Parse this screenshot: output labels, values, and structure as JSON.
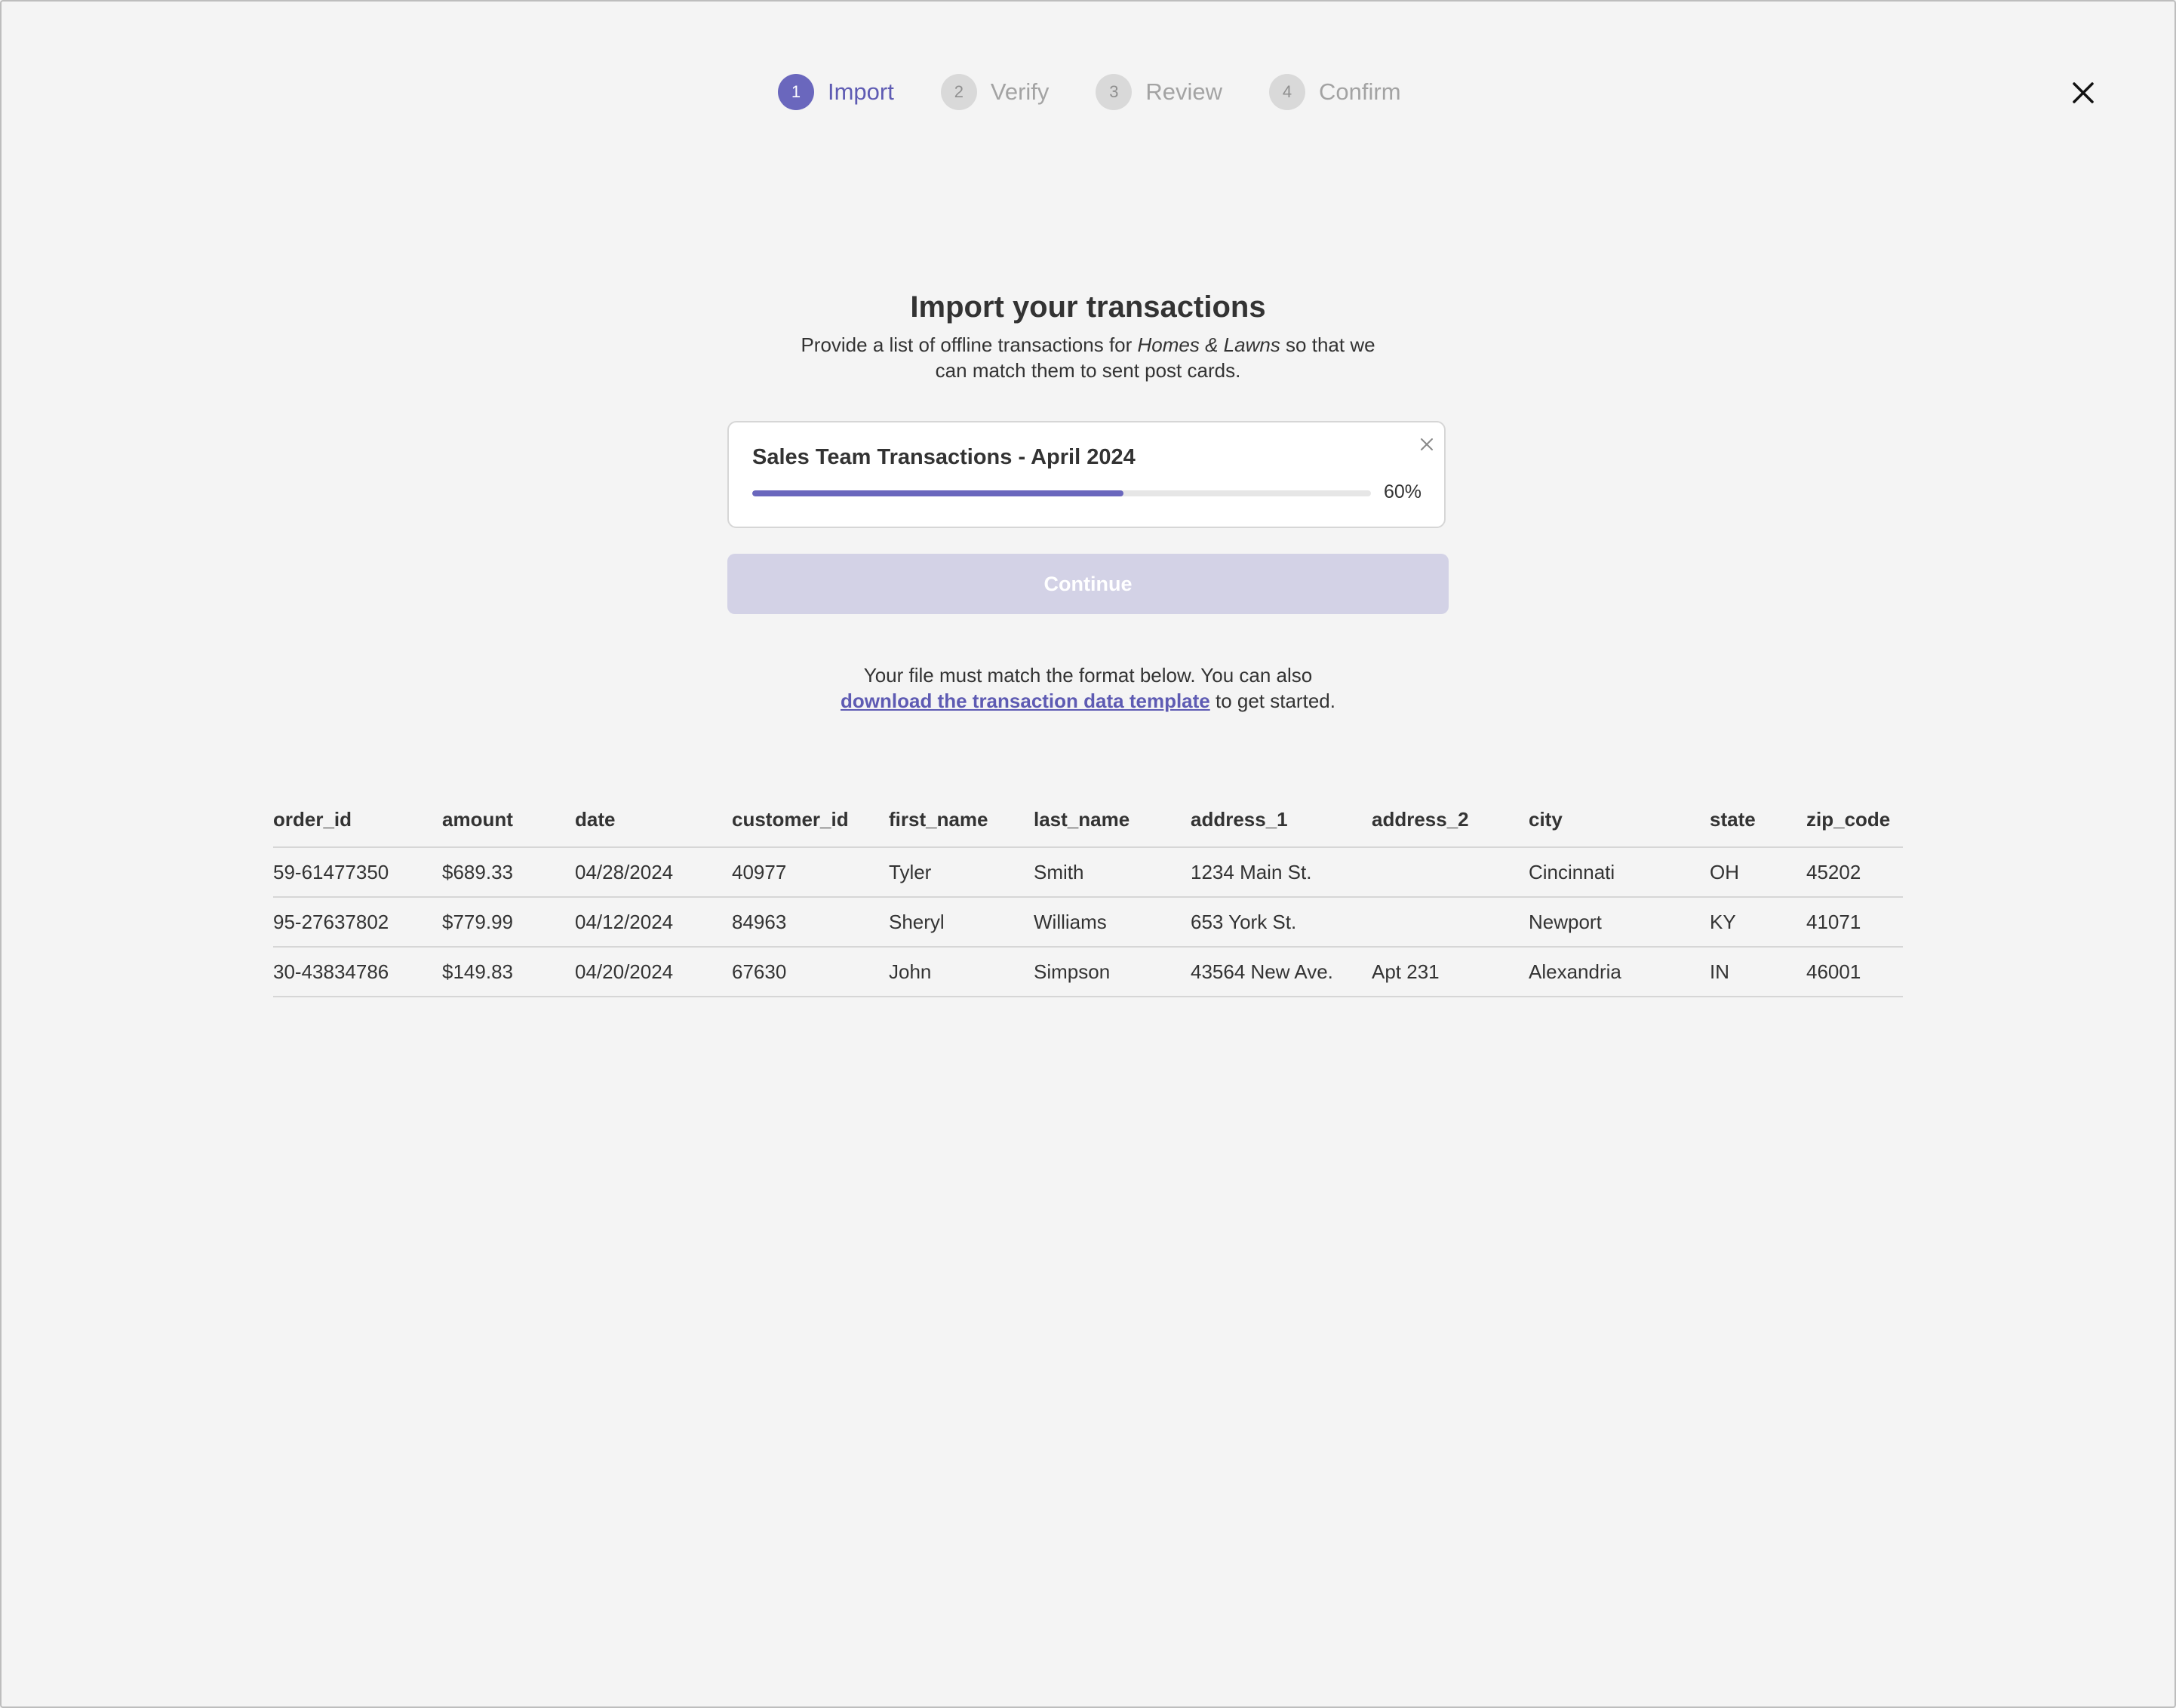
{
  "stepper": {
    "steps": [
      {
        "number": "1",
        "label": "Import",
        "active": true
      },
      {
        "number": "2",
        "label": "Verify",
        "active": false
      },
      {
        "number": "3",
        "label": "Review",
        "active": false
      },
      {
        "number": "4",
        "label": "Confirm",
        "active": false
      }
    ]
  },
  "header": {
    "title": "Import your transactions",
    "subtitle_prefix": "Provide a list of offline transactions for ",
    "subtitle_emphasis": "Homes & Lawns",
    "subtitle_suffix": " so that we can match them to sent post cards."
  },
  "upload": {
    "file_name": "Sales Team Transactions - April 2024",
    "progress_fraction": 0.6,
    "progress_text": "60%"
  },
  "continue_label": "Continue",
  "format_note": {
    "line1": "Your file must match  the format below. You can also",
    "link_text": "download the transaction data template",
    "line2_suffix": " to get started."
  },
  "table": {
    "columns": [
      "order_id",
      "amount",
      "date",
      "customer_id",
      "first_name",
      "last_name",
      "address_1",
      "address_2",
      "city",
      "state",
      "zip_code"
    ],
    "rows": [
      [
        "59-61477350",
        "$689.33",
        "04/28/2024",
        "40977",
        "Tyler",
        "Smith",
        "1234 Main St.",
        "",
        "Cincinnati",
        "OH",
        "45202"
      ],
      [
        "95-27637802",
        "$779.99",
        "04/12/2024",
        "84963",
        "Sheryl",
        "Williams",
        "653 York St.",
        "",
        "Newport",
        "KY",
        "41071"
      ],
      [
        "30-43834786",
        "$149.83",
        "04/20/2024",
        "67630",
        "John",
        "Simpson",
        "43564 New Ave.",
        "Apt 231",
        "Alexandria",
        "IN",
        "46001"
      ]
    ]
  },
  "colors": {
    "accent": "#6a67bd",
    "button_disabled": "#d3d2e6",
    "background": "#f4f4f4"
  },
  "icons": {
    "close": "close-icon",
    "remove_file": "remove-file-icon"
  }
}
